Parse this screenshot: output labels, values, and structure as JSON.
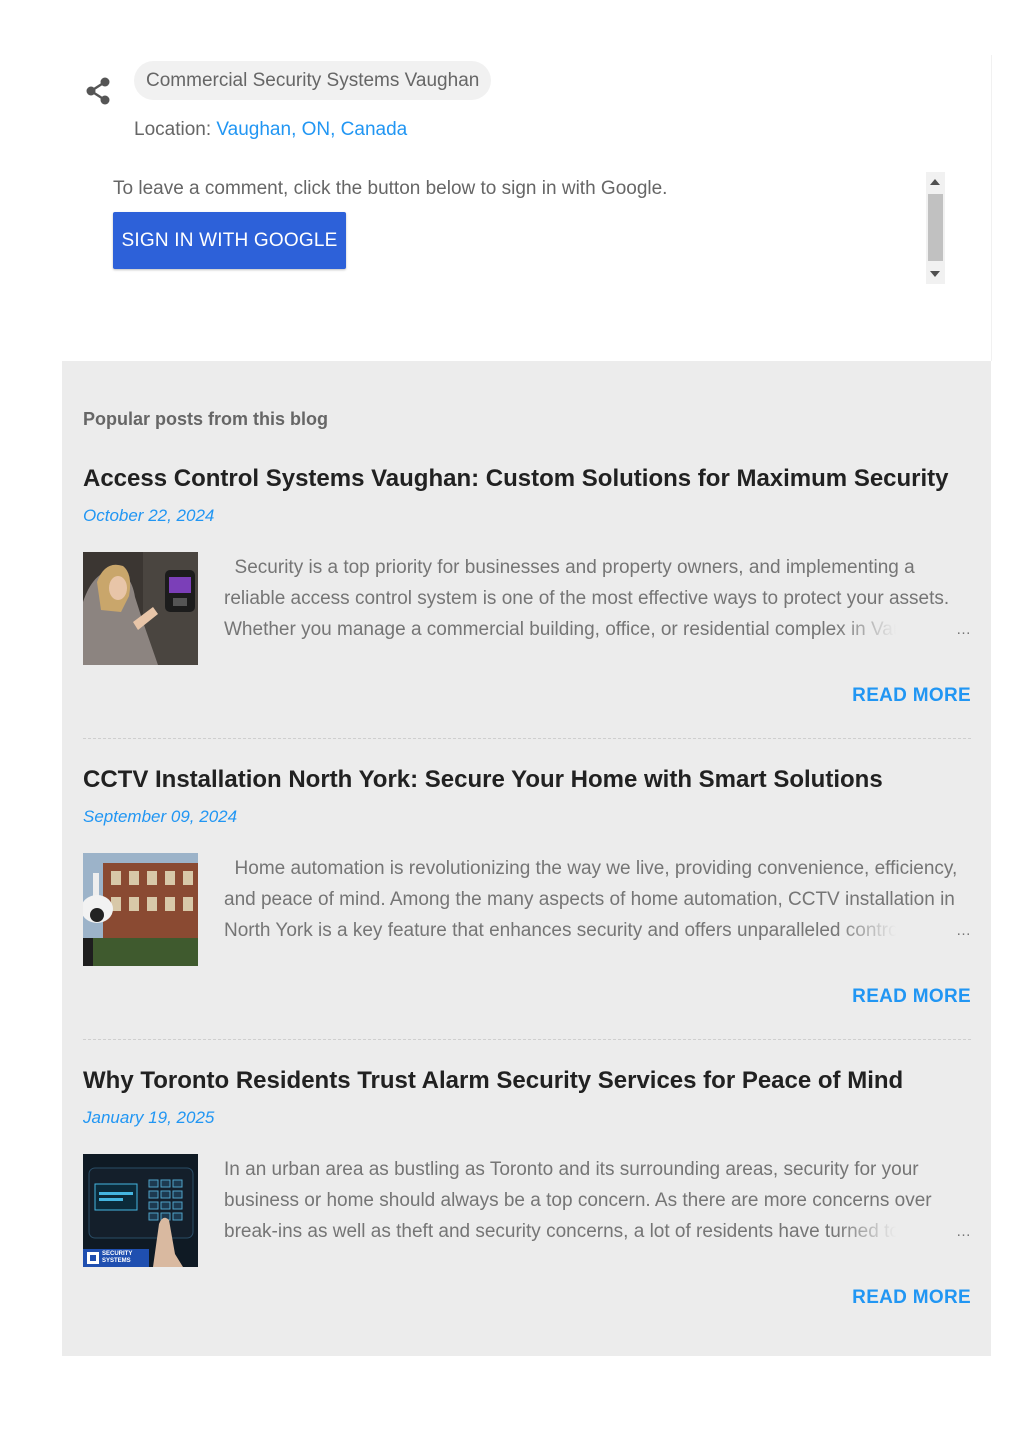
{
  "post_meta": {
    "label": "Commercial Security Systems Vaughan",
    "location_prefix": "Location:",
    "location_value": "Vaughan, ON, Canada"
  },
  "comments": {
    "prompt": "To leave a comment, click the button below to sign in with Google.",
    "signin_label": "SIGN IN WITH GOOGLE"
  },
  "popular": {
    "heading": "Popular posts from this blog",
    "posts": [
      {
        "title": "Access Control Systems Vaughan: Custom Solutions for Maximum Security",
        "date": "October 22, 2024",
        "snippet": "  Security is a top priority for businesses and property owners, and implementing a reliable access control system is one of the most effective ways to protect your assets. Whether you manage a commercial building, office, or residential complex in Vaughan",
        "ellipsis": "…",
        "read_more": "READ MORE"
      },
      {
        "title": "CCTV Installation North York: Secure Your Home with Smart Solutions",
        "date": "September 09, 2024",
        "snippet": "  Home automation is revolutionizing the way we live, providing convenience, efficiency, and peace of mind. Among the many aspects of home automation, CCTV installation in North York is a key feature that enhances security and offers unparalleled control over",
        "ellipsis": "…",
        "read_more": "READ MORE"
      },
      {
        "title": "Why Toronto Residents Trust Alarm Security Services for Peace of Mind",
        "date": "January 19, 2025",
        "snippet": "In an urban area as bustling as Toronto and its surrounding areas, security for your business or home should always be a top concern. As there are more concerns over break-ins as well as theft and security concerns, a lot of residents have turned to",
        "ellipsis": "…",
        "read_more": "READ MORE",
        "thumb_badge": "SECURITY SYSTEMS"
      }
    ]
  },
  "colors": {
    "accent": "#2196f3",
    "button": "#2d61d9",
    "panel": "#ececec"
  }
}
